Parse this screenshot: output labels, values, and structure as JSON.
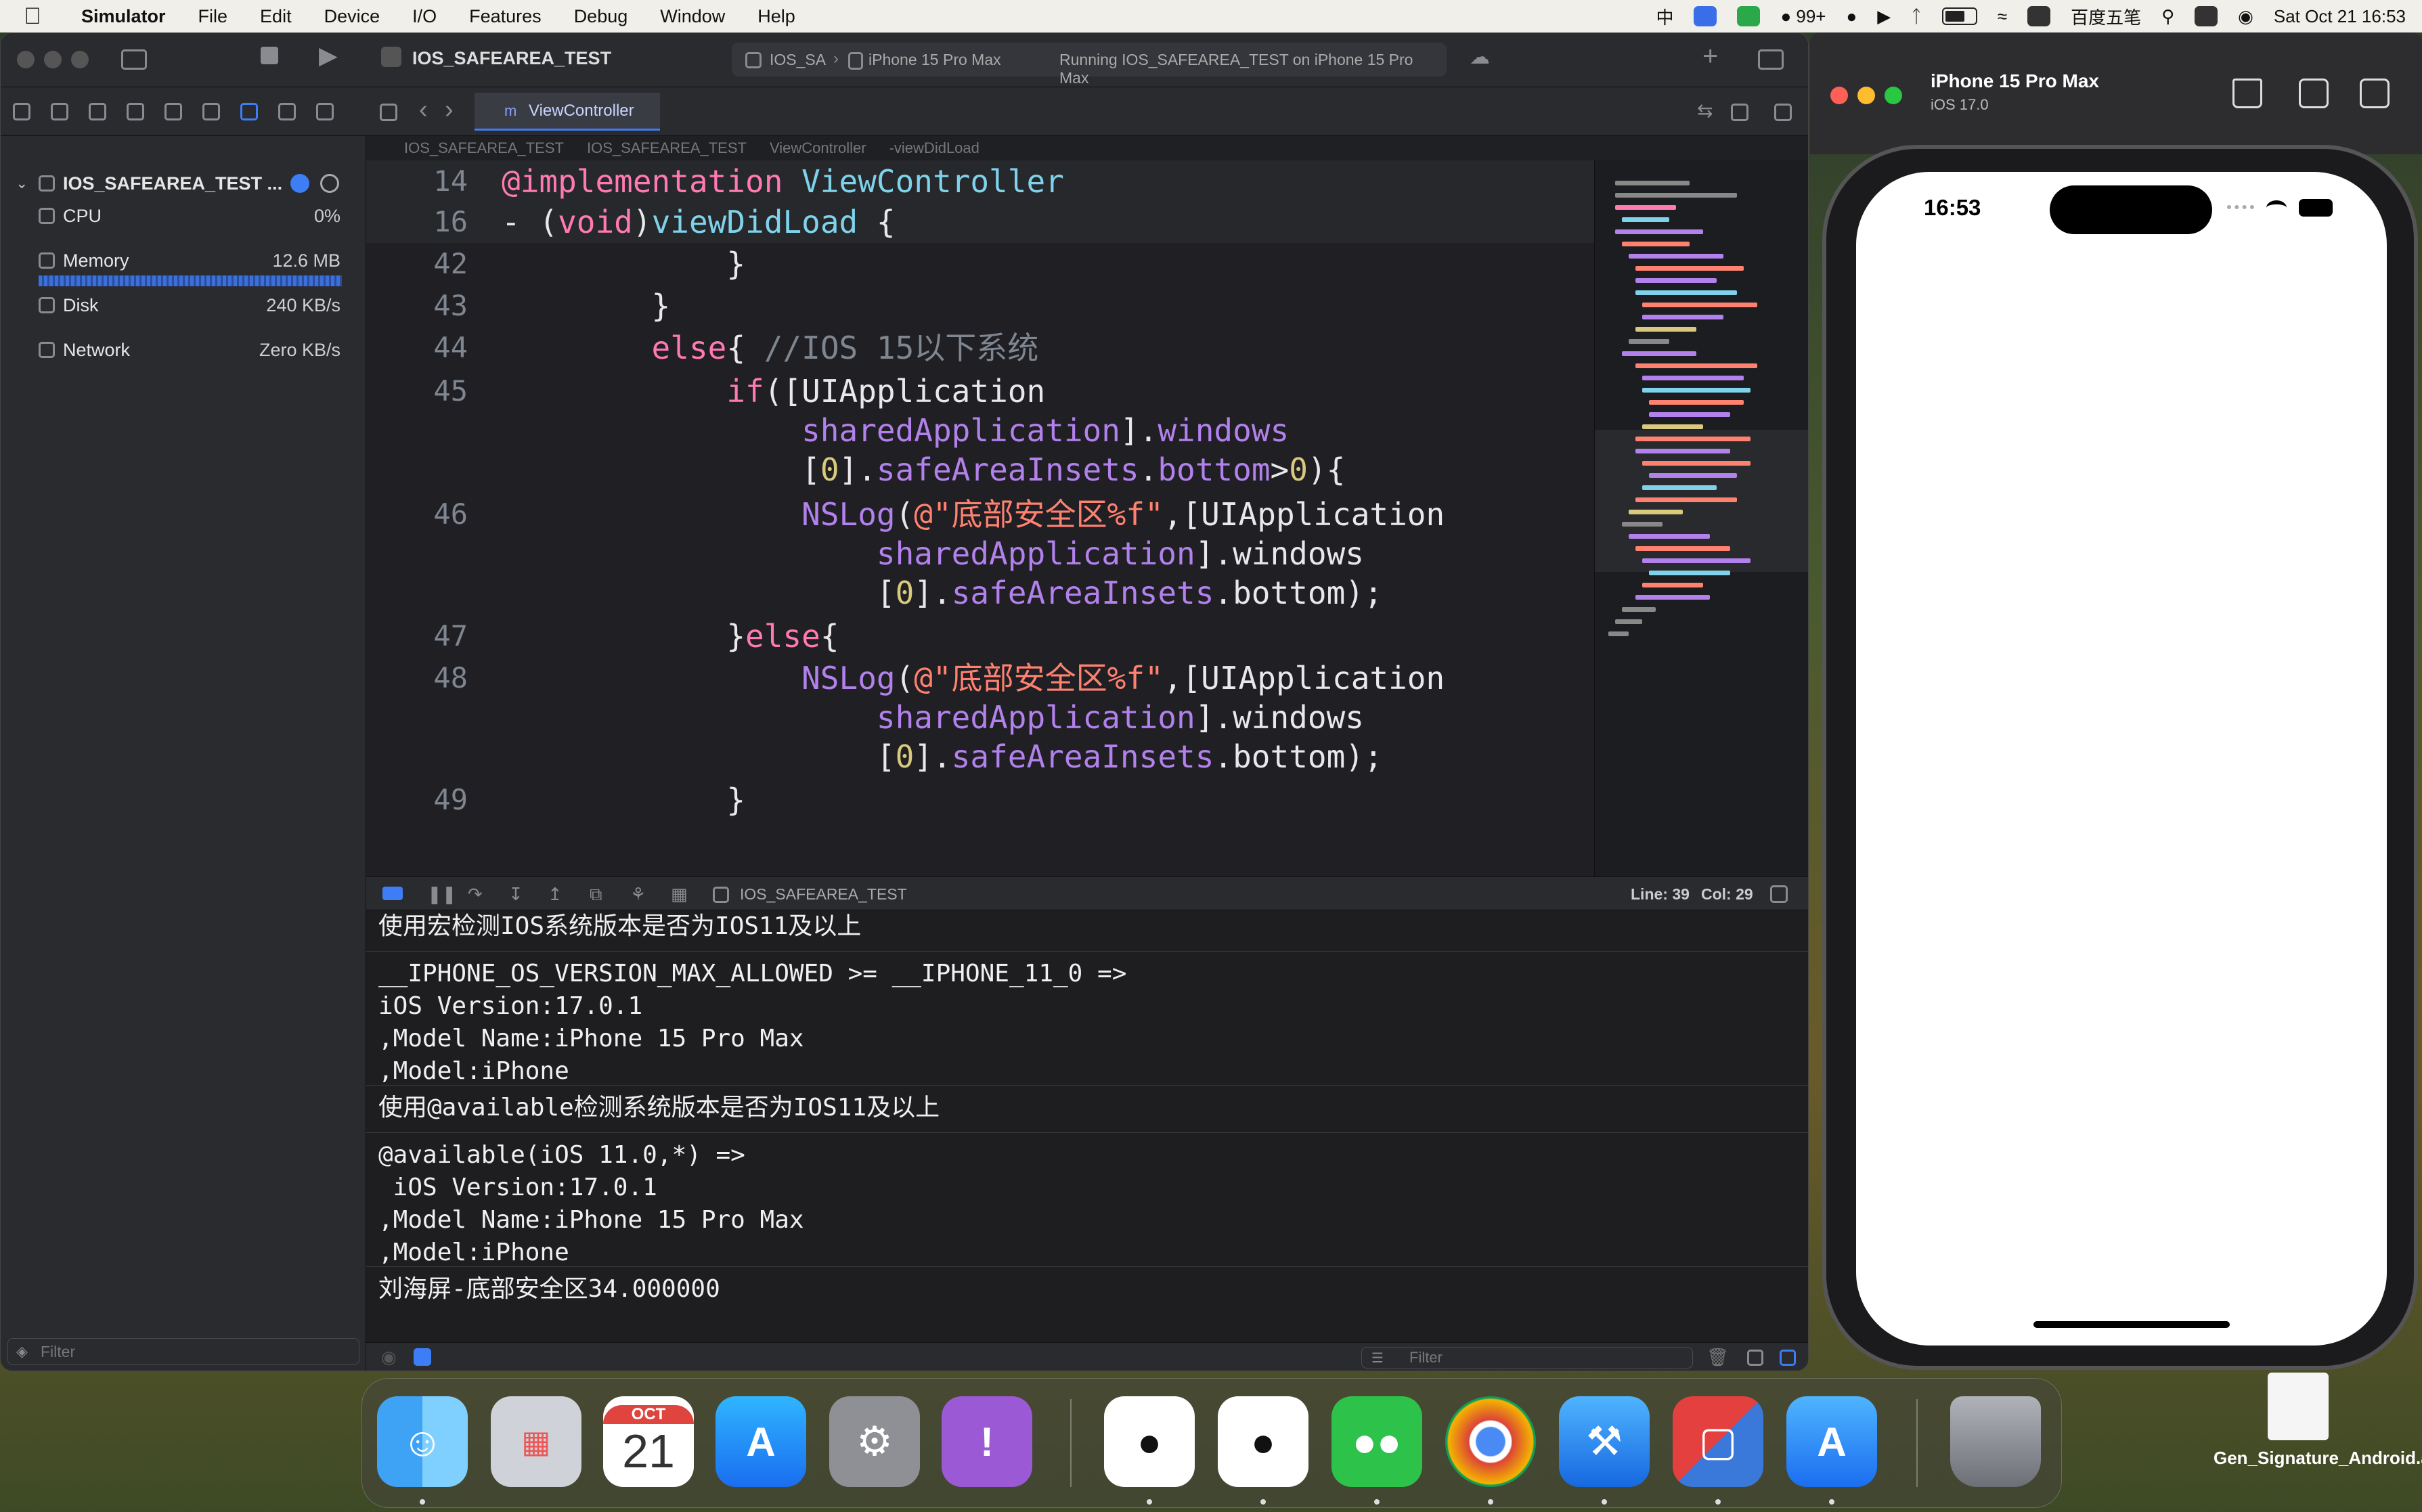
{
  "menubar": {
    "app": "Simulator",
    "items": [
      "File",
      "Edit",
      "Device",
      "I/O",
      "Features",
      "Debug",
      "Window",
      "Help"
    ],
    "status": {
      "input_mode": "中",
      "notifications": "99+",
      "ime": "百度五笔",
      "datetime": "Sat Oct 21  16:53"
    }
  },
  "xcode": {
    "project": "IOS_SAFEAREA_TEST",
    "scheme": "IOS_SA",
    "destination": "iPhone 15 Pro Max",
    "run_status": "Running IOS_SAFEAREA_TEST on iPhone 15 Pro Max",
    "navigator": {
      "target": "IOS_SAFEAREA_TEST ...",
      "gauges": [
        {
          "label": "CPU",
          "value": "0%"
        },
        {
          "label": "Memory",
          "value": "12.6 MB"
        },
        {
          "label": "Disk",
          "value": "240 KB/s"
        },
        {
          "label": "Network",
          "value": "Zero KB/s"
        }
      ],
      "filter_placeholder": "Filter"
    },
    "tab": "ViewController",
    "jumpbar": [
      "IOS_SAFEAREA_TEST",
      "IOS_SAFEAREA_TEST",
      "ViewController",
      "-viewDidLoad"
    ],
    "cursor": {
      "line": "Line: 39",
      "col": "Col: 29"
    },
    "debug_target": "IOS_SAFEAREA_TEST",
    "code": {
      "sticky": [
        {
          "num": "14",
          "segments": [
            {
              "t": "@implementation ",
              "c": "kw"
            },
            {
              "t": "ViewController",
              "c": "cls"
            }
          ]
        },
        {
          "num": "16",
          "segments": [
            {
              "t": "- (",
              "c": "plain"
            },
            {
              "t": "void",
              "c": "kw"
            },
            {
              "t": ")",
              "c": "plain"
            },
            {
              "t": "viewDidLoad",
              "c": "cls"
            },
            {
              "t": " {",
              "c": "plain"
            }
          ]
        }
      ],
      "partial": "[0].safeAreaInsets.bottom);",
      "lines": [
        {
          "num": "42",
          "segments": [
            {
              "t": "            }",
              "c": "plain"
            }
          ]
        },
        {
          "num": "43",
          "segments": [
            {
              "t": "        }",
              "c": "plain"
            }
          ]
        },
        {
          "num": "44",
          "segments": [
            {
              "t": "        else",
              "c": "kw"
            },
            {
              "t": "{ ",
              "c": "plain"
            },
            {
              "t": "//IOS 15以下系统",
              "c": "cmt"
            }
          ]
        },
        {
          "num": "45",
          "segments": [
            {
              "t": "            if",
              "c": "kw"
            },
            {
              "t": "([",
              "c": "plain"
            },
            {
              "t": "UIApplication",
              "c": "plain"
            }
          ]
        },
        {
          "num": "",
          "segments": [
            {
              "t": "                sharedApplication",
              "c": "fn"
            },
            {
              "t": "].",
              "c": "plain"
            },
            {
              "t": "windows",
              "c": "fn"
            }
          ]
        },
        {
          "num": "",
          "segments": [
            {
              "t": "                [",
              "c": "plain"
            },
            {
              "t": "0",
              "c": "num"
            },
            {
              "t": "].",
              "c": "plain"
            },
            {
              "t": "safeAreaInsets",
              "c": "fn"
            },
            {
              "t": ".",
              "c": "plain"
            },
            {
              "t": "bottom",
              "c": "fn"
            },
            {
              "t": ">",
              "c": "plain"
            },
            {
              "t": "0",
              "c": "num"
            },
            {
              "t": "){",
              "c": "plain"
            }
          ]
        },
        {
          "num": "46",
          "segments": [
            {
              "t": "                NSLog",
              "c": "fn"
            },
            {
              "t": "(",
              "c": "plain"
            },
            {
              "t": "@\"底部安全区%f\"",
              "c": "str"
            },
            {
              "t": ",[UIApplication",
              "c": "plain"
            }
          ]
        },
        {
          "num": "",
          "segments": [
            {
              "t": "                    sharedApplication",
              "c": "fn"
            },
            {
              "t": "].windows",
              "c": "plain"
            }
          ]
        },
        {
          "num": "",
          "segments": [
            {
              "t": "                    [",
              "c": "plain"
            },
            {
              "t": "0",
              "c": "num"
            },
            {
              "t": "].",
              "c": "plain"
            },
            {
              "t": "safeAreaInsets",
              "c": "fn"
            },
            {
              "t": ".bottom);",
              "c": "plain"
            }
          ]
        },
        {
          "num": "47",
          "segments": [
            {
              "t": "            }",
              "c": "plain"
            },
            {
              "t": "else",
              "c": "kw"
            },
            {
              "t": "{",
              "c": "plain"
            }
          ]
        },
        {
          "num": "48",
          "segments": [
            {
              "t": "                NSLog",
              "c": "fn"
            },
            {
              "t": "(",
              "c": "plain"
            },
            {
              "t": "@\"底部安全区%f\"",
              "c": "str"
            },
            {
              "t": ",[UIApplication",
              "c": "plain"
            }
          ]
        },
        {
          "num": "",
          "segments": [
            {
              "t": "                    sharedApplication",
              "c": "fn"
            },
            {
              "t": "].windows",
              "c": "plain"
            }
          ]
        },
        {
          "num": "",
          "segments": [
            {
              "t": "                    [",
              "c": "plain"
            },
            {
              "t": "0",
              "c": "num"
            },
            {
              "t": "].",
              "c": "plain"
            },
            {
              "t": "safeAreaInsets",
              "c": "fn"
            },
            {
              "t": ".bottom);",
              "c": "plain"
            }
          ]
        },
        {
          "num": "49",
          "segments": [
            {
              "t": "            }",
              "c": "plain"
            }
          ]
        }
      ]
    },
    "console": {
      "blocks": [
        "使用宏检测IOS系统版本是否为IOS11及以上",
        "__IPHONE_OS_VERSION_MAX_ALLOWED >= __IPHONE_11_0 =>\niOS Version:17.0.1\n,Model Name:iPhone 15 Pro Max\n,Model:iPhone",
        "使用@available检测系统版本是否为IOS11及以上",
        "@available(iOS 11.0,*) =>\n iOS Version:17.0.1\n,Model Name:iPhone 15 Pro Max\n,Model:iPhone",
        "刘海屏-底部安全区34.000000"
      ],
      "filter_placeholder": "Filter"
    }
  },
  "simulator": {
    "device": "iPhone 15 Pro Max",
    "os": "iOS 17.0",
    "time": "16:53"
  },
  "dock": {
    "calendar_month": "OCT",
    "calendar_day": "21",
    "apps": [
      "finder-icon",
      "launchpad-icon",
      "calendar-icon",
      "app-store-icon",
      "system-settings-icon",
      "feedback-icon",
      "qq-icon",
      "qq-icon",
      "wechat-icon",
      "chrome-icon",
      "xcode-icon",
      "parallels-icon",
      "simulator-icon",
      "trash-icon"
    ]
  },
  "desktop": {
    "file": "Gen_Signature_Android.apk"
  }
}
